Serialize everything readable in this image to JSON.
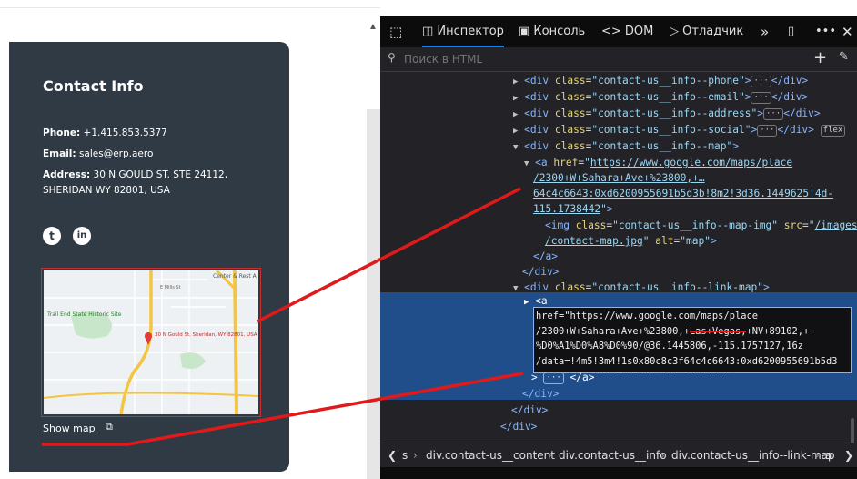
{
  "contact": {
    "title": "Contact Info",
    "phone_label": "Phone:",
    "phone_value": "+1.415.853.5377",
    "email_label": "Email:",
    "email_value": "sales@erp.aero",
    "address_label": "Address:",
    "address_line1": "30 N GOULD ST. STE 24112,",
    "address_line2": "SHERIDAN WY 82801, USA",
    "social": [
      "t",
      "in"
    ],
    "map_labels": {
      "park": "Trail End State Historic Site",
      "pin": "30 N Gould St, Sheridan, WY 82801, USA",
      "poi": "Center & Rest A",
      "street": "E Mills St"
    },
    "show_map_label": "Show map"
  },
  "devtools": {
    "tabs": [
      "Инспектор",
      "Консоль",
      "DOM",
      "Отладчик"
    ],
    "search_placeholder": "Поиск в HTML",
    "add_symbol": "+",
    "lines": {
      "l1_class": "contact-us__info--phone",
      "l2_class": "contact-us__info--email",
      "l3_class": "contact-us__info--address",
      "l4_class": "contact-us__info--social",
      "l4_badge": "flex",
      "l5_class": "contact-us__info--map",
      "l6_href_a": "https://www.google.com/maps/place",
      "l7_href_b": "/2300+W+Sahara+Ave+%23800,+…",
      "l8_href_c": "64c4c6643:0xd6200955691b5d3b!8m2!3d36.1449625!4d-",
      "l9_href_d": "115.1738442",
      "l10_class": "contact-us__info--map-img",
      "l10_src": "/images",
      "l11_src_b": "/contact-map.jpg",
      "l11_alt": "map",
      "l15_class": "contact-us__info--link-map"
    },
    "edit_text": "href=\"https://www.google.com/maps/place\n/2300+W+Sahara+Ave+%23800,+Las+Vegas,+NV+89102,+\n%D0%A1%D0%A8%D0%90/@36.1445806,-115.1757127,16z\n/data=!4m5!3m4!1s0x80c8c3f64c4c6643:0xd6200955691b5d3\nb!8m2!3d36.1449625!4d-115.1738442\"",
    "breadcrumbs": [
      "s",
      "div.contact-us__content",
      "div.contact-us__info",
      "div.contact-us__info--link-map",
      "a"
    ],
    "colors": {
      "accent": "#0a84ff",
      "selection": "#204e8a",
      "card_bg": "#2f3a44",
      "annotation": "#e01a1a"
    }
  }
}
